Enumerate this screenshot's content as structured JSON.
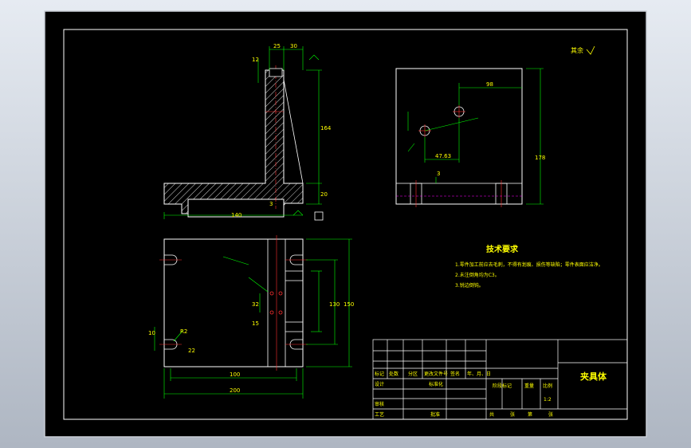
{
  "colors": {
    "background": "#000000",
    "line": "#ffffff",
    "dimension": "#00ff00",
    "text": "#ffff00",
    "centerline": "#ff3030",
    "hidden": "#ff00ff",
    "frame_outer": "#c8cdd6"
  },
  "roughness_note": "其余",
  "top_view_dims": {
    "d25": "25",
    "d30": "30",
    "d12": "12",
    "d164": "164",
    "d20": "20",
    "d140": "140",
    "d3": "3"
  },
  "plan_view_dims": {
    "d100": "100",
    "d200": "200",
    "d130": "130",
    "d150": "150",
    "d32": "32",
    "d15": "15",
    "d10": "10",
    "r2": "R2",
    "d22": "22"
  },
  "side_view_dims": {
    "d98": "98",
    "d178": "178",
    "d4763": "47.63",
    "d3": "3"
  },
  "tech_req": {
    "title": "技术要求",
    "items": [
      "1.零件加工前应去毛刺，不得有划痕、损伤等缺陷；零件表面应洁净。",
      "2.未注倒角均为C3。",
      "3.锐边倒钝。"
    ]
  },
  "title_block": {
    "name": "夹具体",
    "labels": [
      "标记",
      "处数",
      "分区",
      "更改文件号",
      "签名",
      "年、月、日"
    ],
    "designer": "设计",
    "standardization": "标准化",
    "stage_mark": "阶段标记",
    "weight": "重量",
    "scale": "比例",
    "scale_value": "1:2",
    "checker": "审核",
    "process": "工艺",
    "approve": "批准",
    "sheet_total": "共",
    "sheet_label": "张",
    "sheet_no": "第",
    "sheet_label2": "张"
  }
}
